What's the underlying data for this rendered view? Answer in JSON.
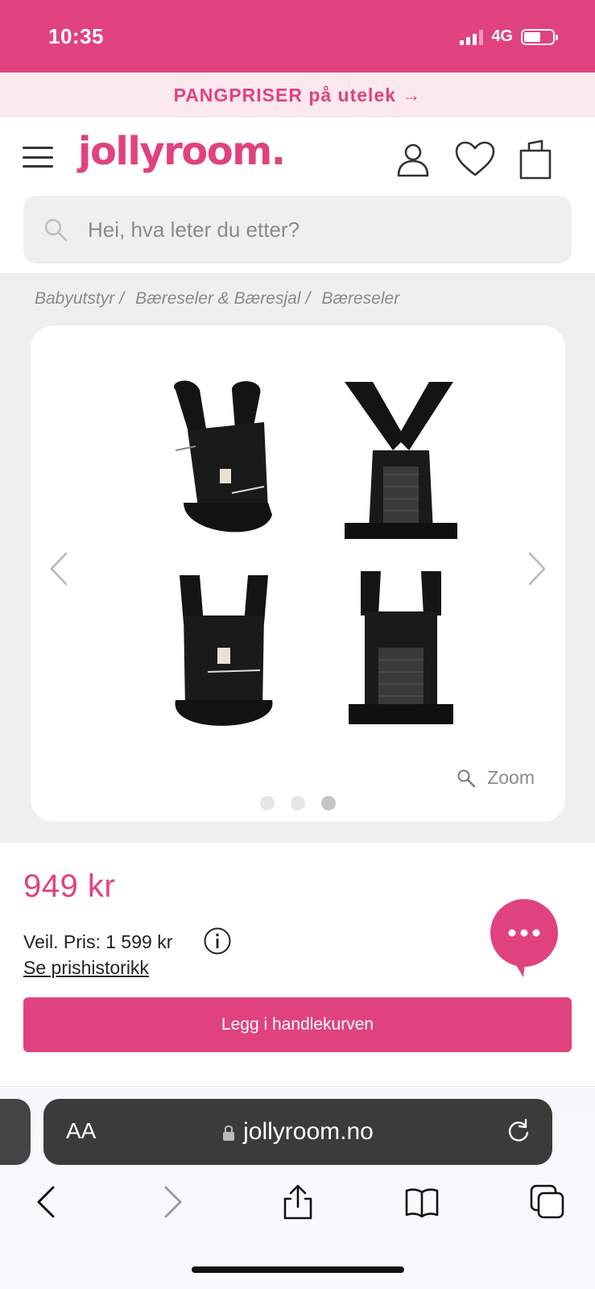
{
  "status_bar": {
    "time": "10:35",
    "network": "4G"
  },
  "promo": {
    "text": "PANGPRISER på utelek →"
  },
  "header": {
    "logo": "jollyroom."
  },
  "search": {
    "placeholder": "Hei, hva leter du etter?"
  },
  "breadcrumb": {
    "items": [
      "Babyutstyr",
      "Bæreseler & Bæresjal",
      "Bæreseler"
    ],
    "separator": "/"
  },
  "gallery": {
    "zoom_label": "Zoom",
    "slide_count": 3,
    "active_slide": 3
  },
  "product": {
    "price": "949 kr",
    "rrp": "Veil. Pris: 1 599 kr",
    "price_history": "Se prishistorikk",
    "cart_button": "Legg i handlekurven"
  },
  "browser": {
    "aa": "AA",
    "url": "jollyroom.no"
  },
  "colors": {
    "brand": "#e0427f",
    "promo_bg": "#fce8ef",
    "page_bg": "#efefef"
  },
  "icons": [
    "hamburger-icon",
    "account-icon",
    "heart-icon",
    "bag-icon",
    "search-icon",
    "chevron-left-icon",
    "chevron-right-icon",
    "zoom-icon",
    "info-icon",
    "chat-icon",
    "lock-icon",
    "reload-icon",
    "back-icon",
    "forward-icon",
    "share-icon",
    "bookmarks-icon",
    "tabs-icon"
  ]
}
